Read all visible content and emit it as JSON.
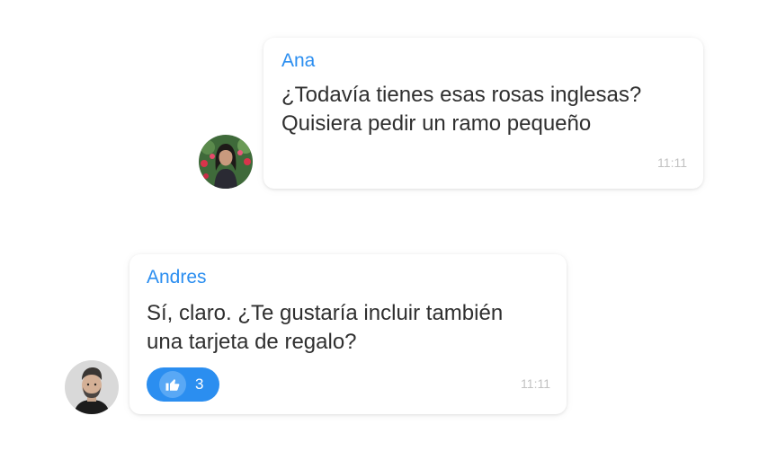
{
  "messages": [
    {
      "author": "Ana",
      "text": "¿Todavía tienes esas rosas inglesas?\nQuisiera pedir un ramo pequeño",
      "time": "11:11"
    },
    {
      "author": "Andres",
      "text": "Sí, claro. ¿Te gustaría incluir también\nuna tarjeta de regalo?",
      "time": "11:11",
      "reaction": {
        "icon": "thumbs-up-icon",
        "count": "3"
      }
    }
  ],
  "colors": {
    "accent": "#2b8ef0",
    "text": "#2f2f2f",
    "timestamp": "#c2c2c2",
    "reaction_icon_bg": "#59a8f5"
  }
}
